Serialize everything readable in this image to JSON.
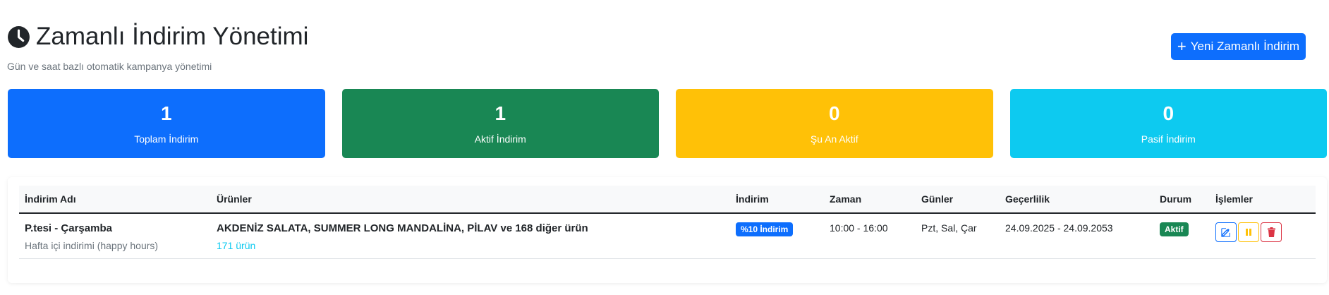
{
  "header": {
    "title": "Zamanlı İndirim Yönetimi",
    "subtitle": "Gün ve saat bazlı otomatik kampanya yönetimi",
    "icon": "clock-icon",
    "new_button_label": "Yeni Zamanlı İndirim"
  },
  "stats": [
    {
      "value": "1",
      "label": "Toplam İndirim",
      "color": "#0d6efd"
    },
    {
      "value": "1",
      "label": "Aktif İndirim",
      "color": "#198754"
    },
    {
      "value": "0",
      "label": "Şu An Aktif",
      "color": "#ffc107"
    },
    {
      "value": "0",
      "label": "Pasif İndirim",
      "color": "#0dcaf0"
    }
  ],
  "table": {
    "columns": [
      "İndirim Adı",
      "Ürünler",
      "İndirim",
      "Zaman",
      "Günler",
      "Geçerlilik",
      "Durum",
      "İşlemler"
    ],
    "rows": [
      {
        "name": "P.tesi - Çarşamba",
        "description": "Hafta içi indirimi (happy hours)",
        "products": "AKDENİZ SALATA, SUMMER LONG MANDALİNA, PİLAV ve 168 diğer ürün",
        "product_count": "171 ürün",
        "discount": "%10 İndirim",
        "time": "10:00 - 16:00",
        "days": "Pzt, Sal, Çar",
        "validity": "24.09.2025 - 24.09.2053",
        "status": "Aktif",
        "actions": [
          "edit-icon",
          "pause-icon",
          "trash-icon"
        ]
      }
    ]
  }
}
